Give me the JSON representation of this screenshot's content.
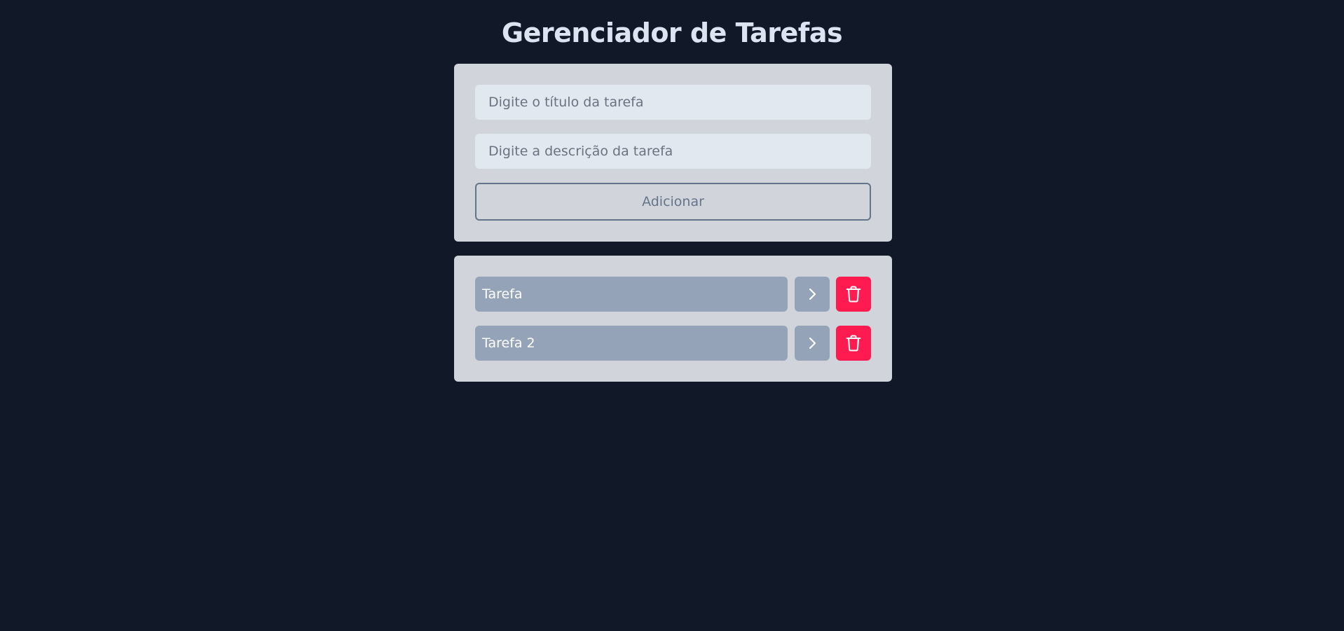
{
  "header": {
    "title": "Gerenciador de Tarefas"
  },
  "form": {
    "title_placeholder": "Digite o título da tarefa",
    "title_value": "",
    "description_placeholder": "Digite a descrição da tarefa",
    "description_value": "",
    "add_label": "Adicionar"
  },
  "tasks": [
    {
      "title": "Tarefa",
      "details_icon": "chevron-right-icon",
      "delete_icon": "trash-icon"
    },
    {
      "title": "Tarefa 2",
      "details_icon": "chevron-right-icon",
      "delete_icon": "trash-icon"
    }
  ],
  "colors": {
    "background": "#111827",
    "card": "#d1d5db",
    "input": "#e2e8f0",
    "task": "#94a3b8",
    "delete": "#ff1a4f",
    "title": "#dbe4f0",
    "button_border": "#64748b"
  }
}
